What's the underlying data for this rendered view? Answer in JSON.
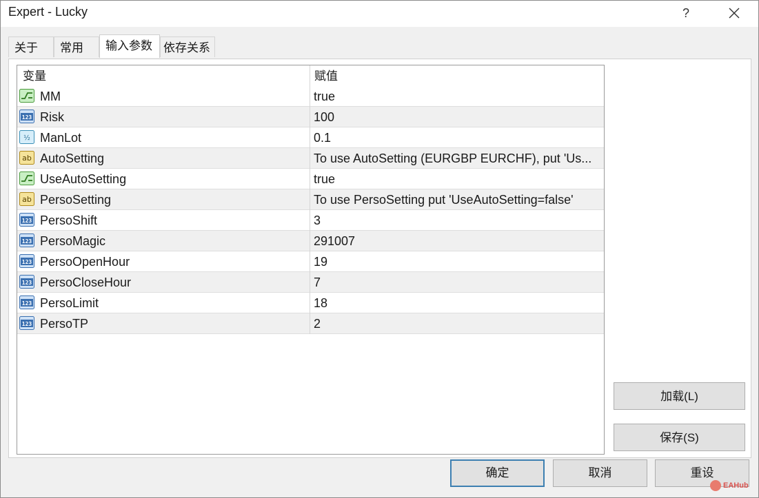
{
  "window": {
    "title": "Expert - Lucky",
    "help_label": "?"
  },
  "tabs": [
    {
      "label": "关于"
    },
    {
      "label": "常用"
    },
    {
      "label": "输入参数"
    },
    {
      "label": "依存关系"
    }
  ],
  "active_tab_index": 2,
  "table": {
    "columns": [
      "变量",
      "赋值"
    ],
    "rows": [
      {
        "name": "MM",
        "value": "true",
        "icon": "bool-icon"
      },
      {
        "name": "Risk",
        "value": "100",
        "icon": "int-icon"
      },
      {
        "name": "ManLot",
        "value": "0.1",
        "icon": "double-icon"
      },
      {
        "name": "AutoSetting",
        "value": "To use AutoSetting (EURGBP EURCHF), put 'Us...",
        "icon": "string-icon"
      },
      {
        "name": "UseAutoSetting",
        "value": "true",
        "icon": "bool-icon"
      },
      {
        "name": "PersoSetting",
        "value": "To use PersoSetting put 'UseAutoSetting=false'",
        "icon": "string-icon"
      },
      {
        "name": "PersoShift",
        "value": "3",
        "icon": "int-icon"
      },
      {
        "name": "PersoMagic",
        "value": "291007",
        "icon": "int-icon"
      },
      {
        "name": "PersoOpenHour",
        "value": "19",
        "icon": "int-icon"
      },
      {
        "name": "PersoCloseHour",
        "value": "7",
        "icon": "int-icon"
      },
      {
        "name": "PersoLimit",
        "value": "18",
        "icon": "int-icon"
      },
      {
        "name": "PersoTP",
        "value": "2",
        "icon": "int-icon"
      }
    ]
  },
  "side_buttons": {
    "load": "加载(L)",
    "save": "保存(S)"
  },
  "footer_buttons": {
    "ok": "确定",
    "cancel": "取消",
    "reset": "重设"
  },
  "watermark": "EAHub",
  "colors": {
    "row_alt": "#f0f0f0",
    "default_button_border": "#3c7fb1",
    "button_face": "#e1e1e1"
  }
}
